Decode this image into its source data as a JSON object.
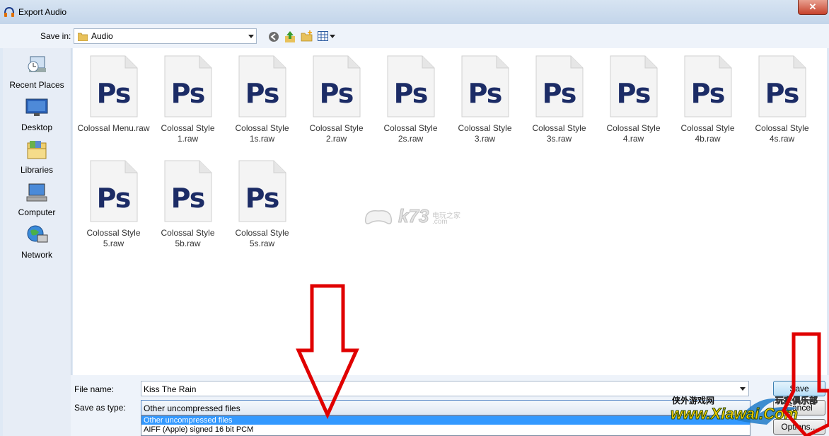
{
  "window": {
    "title": "Export Audio",
    "close_glyph": "✕"
  },
  "toolbar": {
    "save_in_label": "Save in:",
    "location": "Audio",
    "back_icon": "back-arrow-icon",
    "up_icon": "up-folder-icon",
    "new_folder_icon": "new-folder-icon",
    "view_icon": "view-menu-icon"
  },
  "places": [
    {
      "label": "Recent Places",
      "icon": "recent-places-icon"
    },
    {
      "label": "Desktop",
      "icon": "desktop-icon"
    },
    {
      "label": "Libraries",
      "icon": "libraries-icon"
    },
    {
      "label": "Computer",
      "icon": "computer-icon"
    },
    {
      "label": "Network",
      "icon": "network-icon"
    }
  ],
  "files": [
    {
      "line1": "Colossal Menu.raw",
      "line2": ""
    },
    {
      "line1": "Colossal Style",
      "line2": "1.raw"
    },
    {
      "line1": "Colossal Style",
      "line2": "1s.raw"
    },
    {
      "line1": "Colossal Style",
      "line2": "2.raw"
    },
    {
      "line1": "Colossal Style",
      "line2": "2s.raw"
    },
    {
      "line1": "Colossal Style",
      "line2": "3.raw"
    },
    {
      "line1": "Colossal Style",
      "line2": "3s.raw"
    },
    {
      "line1": "Colossal Style",
      "line2": "4.raw"
    },
    {
      "line1": "Colossal Style",
      "line2": "4b.raw"
    },
    {
      "line1": "Colossal Style",
      "line2": "4s.raw"
    },
    {
      "line1": "Colossal Style",
      "line2": "5.raw"
    },
    {
      "line1": "Colossal Style",
      "line2": "5b.raw"
    },
    {
      "line1": "Colossal Style",
      "line2": "5s.raw"
    }
  ],
  "file_icon_text": "Ps",
  "form": {
    "file_name_label": "File name:",
    "file_name_value": "Kiss The Rain",
    "save_as_type_label": "Save as type:",
    "save_as_type_value": "Other uncompressed files",
    "type_options": [
      "Other uncompressed files",
      "AIFF (Apple) signed 16 bit PCM"
    ]
  },
  "buttons": {
    "save": "Save",
    "cancel": "Cancel",
    "options": "Options..."
  },
  "watermarks": {
    "center_brand": "k73",
    "center_sub": "电玩之家",
    "center_domain": ".com",
    "corner_line1": "侠外游戏网",
    "corner_line2": "玩家俱乐部",
    "corner_site": "www.Xiawai.Com"
  },
  "colors": {
    "annotation_arrow": "#e00000",
    "ps_text": "#1c2c66",
    "selection": "#3399ff"
  }
}
